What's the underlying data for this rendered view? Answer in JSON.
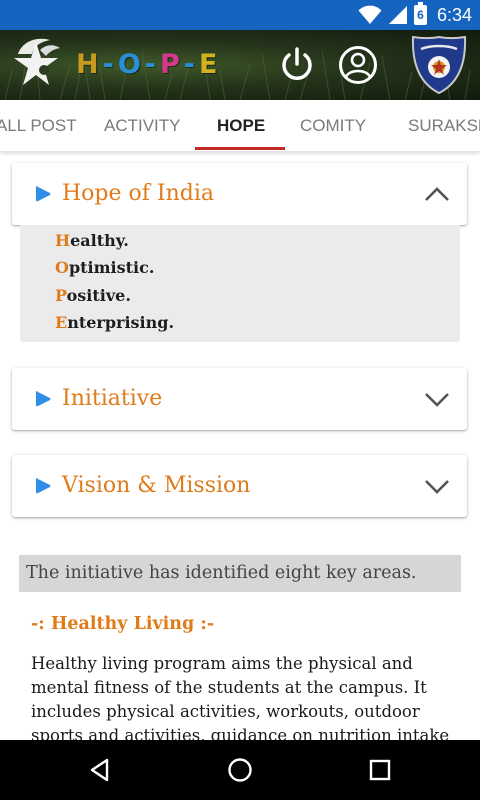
{
  "status_bar": {
    "time": "6:34",
    "battery_level": "6",
    "icons": [
      "wifi-icon",
      "cell-signal-icon",
      "battery-icon"
    ],
    "color": "#1565c0"
  },
  "header": {
    "title_letters": [
      "H",
      "-",
      "O",
      "-",
      "P",
      "-",
      "E"
    ],
    "title_colors": [
      "#c79a1e",
      "#2b8fd6",
      "#2b8fd6",
      "#2b8fd6",
      "#d6398c",
      "#2b8fd6",
      "#d2b21e"
    ],
    "icons": [
      "hope-logo-icon",
      "power-icon",
      "profile-icon",
      "police-badge-icon"
    ]
  },
  "tabs": [
    {
      "label": "ALL POST",
      "active": false
    },
    {
      "label": "ACTIVITY",
      "active": false
    },
    {
      "label": "HOPE",
      "active": true
    },
    {
      "label": "COMITY",
      "active": false
    },
    {
      "label": "SURAKSHA",
      "active": false
    }
  ],
  "accordion": [
    {
      "title": "Hope of India",
      "expanded": true,
      "icon": "chevron-up-icon"
    },
    {
      "title": "Initiative",
      "expanded": false,
      "icon": "chevron-down-icon"
    },
    {
      "title": "Vision & Mission",
      "expanded": false,
      "icon": "chevron-down-icon"
    }
  ],
  "hope_acronym": [
    {
      "initial": "H",
      "rest": "ealthy."
    },
    {
      "initial": "O",
      "rest": "ptimistic."
    },
    {
      "initial": "P",
      "rest": "ositive."
    },
    {
      "initial": "E",
      "rest": "nterprising."
    }
  ],
  "content": {
    "intro": "The initiative has identified eight key areas.",
    "section_heading": "-: Healthy Living :-",
    "body": "Healthy living program aims the physical and mental fitness of the students at the campus. It includes physical activities, workouts, outdoor sports and activities, guidance on nutrition intake"
  },
  "colors": {
    "accent_orange": "#e07b1a",
    "tab_indicator": "#c62828",
    "play_blue": "#2f8fe6"
  },
  "nav_bar": {
    "icons": [
      "back-icon",
      "home-icon",
      "recents-icon"
    ]
  }
}
